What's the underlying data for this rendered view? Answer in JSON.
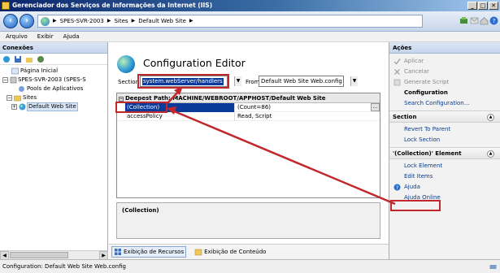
{
  "window": {
    "title": "Gerenciador dos Serviços de Informações da Internet (IIS)"
  },
  "address": {
    "crumbs": [
      "SPES-SVR-2003",
      "Sites",
      "Default Web Site"
    ]
  },
  "menu": [
    "Arquivo",
    "Exibir",
    "Ajuda"
  ],
  "connections": {
    "header": "Conexões",
    "tree": [
      {
        "label": "Página Inicial"
      },
      {
        "label": "SPES-SVR-2003 (SPES-S"
      },
      {
        "label": "Pools de Aplicativos"
      },
      {
        "label": "Sites"
      },
      {
        "label": "Default Web Site"
      }
    ]
  },
  "editor": {
    "title": "Configuration Editor",
    "section_label": "Section:",
    "section_value": "system.webServer/handlers",
    "from_label": "From:",
    "from_value": "Default Web Site Web.config",
    "path_header": "Deepest Path: MACHINE/WEBROOT/APPHOST/Default Web Site",
    "rows": [
      {
        "name": "(Collection)",
        "value": "(Count=86)"
      },
      {
        "name": "accessPolicy",
        "value": "Read, Script"
      }
    ],
    "description": "(Collection)"
  },
  "views": {
    "features": "Exibição de Recursos",
    "content": "Exibição de Conteúdo"
  },
  "actions": {
    "header": "Ações",
    "top": [
      "Aplicar",
      "Cancelar",
      "Generate Script",
      "Configuration",
      "Search Configuration..."
    ],
    "section_title": "Section",
    "section_items": [
      "Revert To Parent",
      "Lock Section"
    ],
    "element_title": "'(Collection)' Element",
    "element_items": [
      "Lock Element",
      "Edit Items"
    ],
    "help": [
      "Ajuda",
      "Ajuda Online"
    ]
  },
  "status": {
    "text": "Configuration: Default Web Site Web.config"
  },
  "colors": {
    "highlight": "#c0282d",
    "selection": "#0a3a9a"
  }
}
